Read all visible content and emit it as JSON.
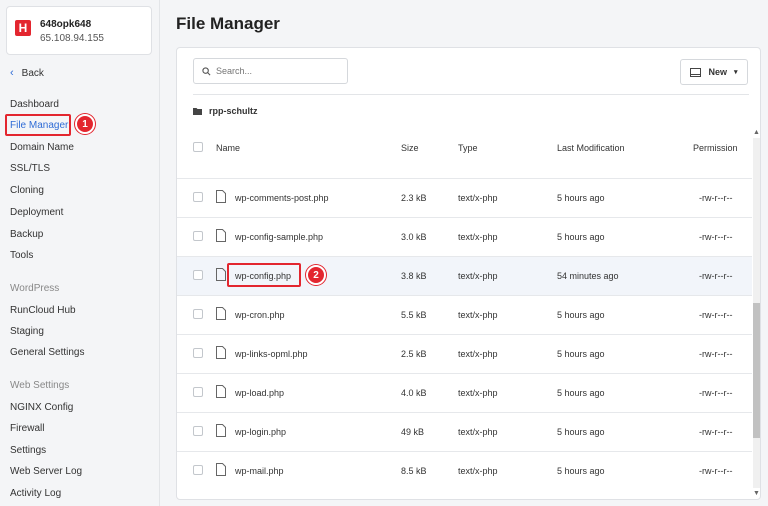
{
  "server": {
    "logo_letter": "H",
    "name": "648opk648",
    "ip": "65.108.94.155"
  },
  "sidebar": {
    "back_label": "Back",
    "items": [
      {
        "label": "Dashboard"
      },
      {
        "label": "File Manager"
      },
      {
        "label": "Domain Name"
      },
      {
        "label": "SSL/TLS"
      },
      {
        "label": "Cloning"
      },
      {
        "label": "Deployment"
      },
      {
        "label": "Backup"
      },
      {
        "label": "Tools"
      }
    ],
    "section_wordpress": "WordPress",
    "wordpress_items": [
      {
        "label": "RunCloud Hub"
      },
      {
        "label": "Staging"
      },
      {
        "label": "General Settings"
      }
    ],
    "section_web": "Web Settings",
    "web_items": [
      {
        "label": "NGINX Config"
      },
      {
        "label": "Firewall"
      },
      {
        "label": "Settings"
      },
      {
        "label": "Web Server Log"
      },
      {
        "label": "Activity Log"
      }
    ]
  },
  "annotations": {
    "badge1": "1",
    "badge2": "2"
  },
  "main": {
    "title": "File Manager",
    "search_placeholder": "Search...",
    "new_button": "New",
    "breadcrumb": "rpp-schultz",
    "columns": {
      "name": "Name",
      "size": "Size",
      "type": "Type",
      "modified": "Last Modification",
      "permission": "Permission"
    },
    "files": [
      {
        "name": "wp-comments-post.php",
        "size": "2.3 kB",
        "type": "text/x-php",
        "modified": "5 hours ago",
        "permission": "-rw-r--r--"
      },
      {
        "name": "wp-config-sample.php",
        "size": "3.0 kB",
        "type": "text/x-php",
        "modified": "5 hours ago",
        "permission": "-rw-r--r--"
      },
      {
        "name": "wp-config.php",
        "size": "3.8 kB",
        "type": "text/x-php",
        "modified": "54 minutes ago",
        "permission": "-rw-r--r--"
      },
      {
        "name": "wp-cron.php",
        "size": "5.5 kB",
        "type": "text/x-php",
        "modified": "5 hours ago",
        "permission": "-rw-r--r--"
      },
      {
        "name": "wp-links-opml.php",
        "size": "2.5 kB",
        "type": "text/x-php",
        "modified": "5 hours ago",
        "permission": "-rw-r--r--"
      },
      {
        "name": "wp-load.php",
        "size": "4.0 kB",
        "type": "text/x-php",
        "modified": "5 hours ago",
        "permission": "-rw-r--r--"
      },
      {
        "name": "wp-login.php",
        "size": "49 kB",
        "type": "text/x-php",
        "modified": "5 hours ago",
        "permission": "-rw-r--r--"
      },
      {
        "name": "wp-mail.php",
        "size": "8.5 kB",
        "type": "text/x-php",
        "modified": "5 hours ago",
        "permission": "-rw-r--r--"
      }
    ]
  },
  "colors": {
    "accent": "#2f6cd6",
    "highlight": "#e3262f"
  }
}
